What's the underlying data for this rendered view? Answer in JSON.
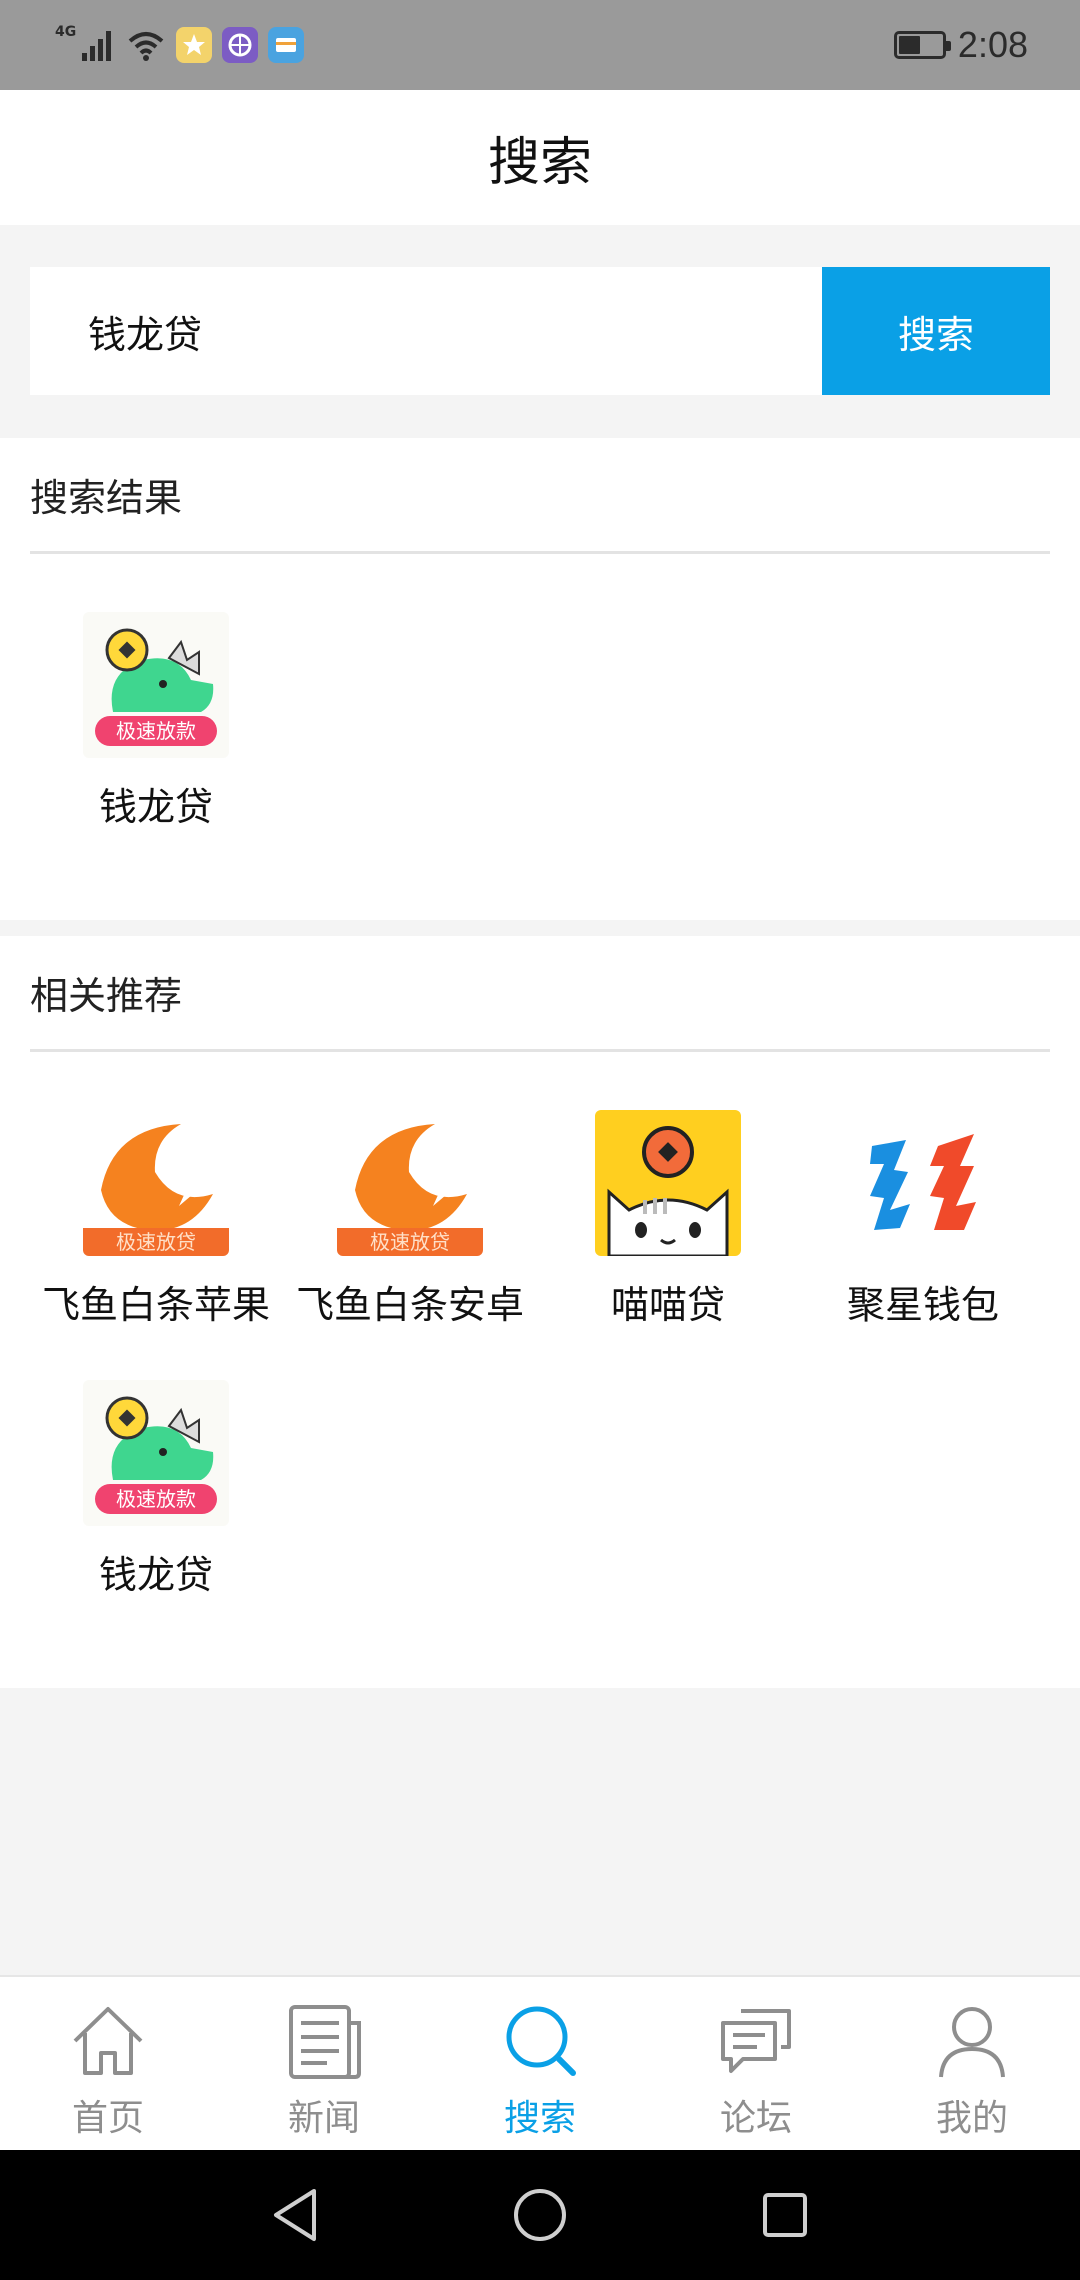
{
  "status_bar": {
    "network": "4G",
    "time": "2:08",
    "battery_level": 0.45,
    "notification_icons": [
      "star-app-icon",
      "globe-app-icon",
      "card-app-icon"
    ]
  },
  "header": {
    "title": "搜索"
  },
  "search": {
    "value": "钱龙贷",
    "placeholder": "",
    "button_label": "搜索"
  },
  "results": {
    "title": "搜索结果",
    "items": [
      {
        "name": "钱龙贷",
        "icon": "dragon-loan-icon"
      }
    ]
  },
  "recommend": {
    "title": "相关推荐",
    "items": [
      {
        "name": "飞鱼白条苹果",
        "icon": "flying-fish-icon",
        "badge": "极速放贷"
      },
      {
        "name": "飞鱼白条安卓",
        "icon": "flying-fish-icon",
        "badge": "极速放贷"
      },
      {
        "name": "喵喵贷",
        "icon": "cat-loan-icon"
      },
      {
        "name": "聚星钱包",
        "icon": "star-wallet-icon"
      },
      {
        "name": "钱龙贷",
        "icon": "dragon-loan-icon",
        "badge": "极速放款"
      }
    ]
  },
  "dragon_badge": "极速放款",
  "bottom_nav": [
    {
      "label": "首页",
      "icon": "home-icon",
      "active": false
    },
    {
      "label": "新闻",
      "icon": "news-icon",
      "active": false
    },
    {
      "label": "搜索",
      "icon": "search-icon",
      "active": true
    },
    {
      "label": "论坛",
      "icon": "forum-icon",
      "active": false
    },
    {
      "label": "我的",
      "icon": "profile-icon",
      "active": false
    }
  ],
  "colors": {
    "accent": "#0aa0e6",
    "status_bar": "#9a9a9a",
    "inactive_nav": "#8e8e8e"
  }
}
